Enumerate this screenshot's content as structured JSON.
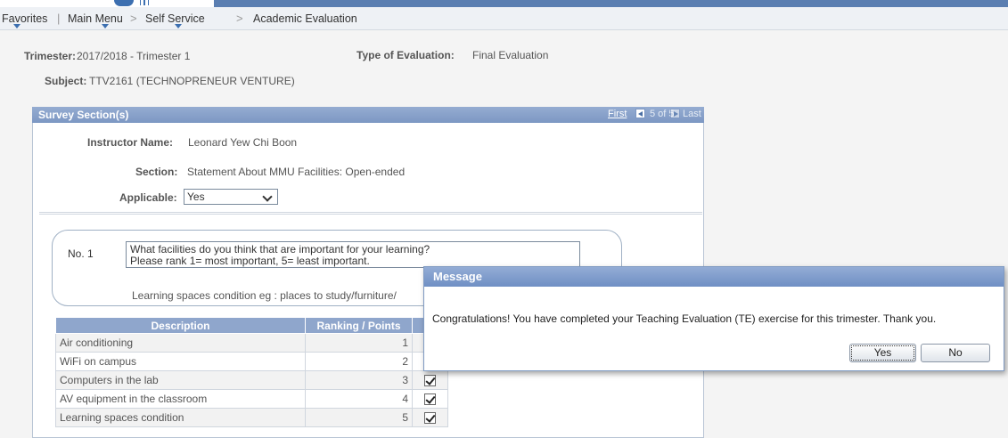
{
  "nav": {
    "favorites": "Favorites",
    "main_menu": "Main Menu",
    "self_service": "Self Service",
    "academic_evaluation": "Academic Evaluation",
    "separator": ">"
  },
  "header": {
    "trimester_label": "Trimester:",
    "trimester_value": "2017/2018 - Trimester 1",
    "type_label": "Type of Evaluation:",
    "type_value": "Final Evaluation",
    "subject_label": "Subject:",
    "subject_value": "TTV2161 (TECHNOPRENEUR VENTURE)"
  },
  "survey": {
    "title": "Survey Section(s)",
    "pager_first": "First",
    "pager_position": "5 of 5",
    "pager_last": "Last",
    "instructor_label": "Instructor Name:",
    "instructor_value": "Leonard Yew Chi Boon",
    "section_label": "Section:",
    "section_value": "Statement About MMU Facilities: Open-ended",
    "applicable_label": "Applicable:",
    "applicable_value": "Yes"
  },
  "question": {
    "number": "No. 1",
    "text_line1": "What facilities do you think that are important for your learning?",
    "text_line2": "Please rank 1= most important, 5= least important.",
    "footer": "Learning spaces condition eg : places to study/furniture/"
  },
  "table": {
    "headers": [
      "Description",
      "Ranking / Points"
    ],
    "rows": [
      {
        "description": "Air conditioning",
        "rank": "1"
      },
      {
        "description": "WiFi on campus",
        "rank": "2"
      },
      {
        "description": "Computers in the lab",
        "rank": "3"
      },
      {
        "description": "AV equipment in the classroom",
        "rank": "4"
      },
      {
        "description": "Learning spaces condition",
        "rank": "5"
      }
    ]
  },
  "dialog": {
    "title": "Message",
    "message": "Congratulations! You have completed your Teaching Evaluation (TE) exercise for this trimester. Thank you.",
    "yes_label": "Yes",
    "no_label": "No"
  },
  "colors": {
    "header_blue": "#7c97c3",
    "accent_blue": "#3c6fb0"
  }
}
